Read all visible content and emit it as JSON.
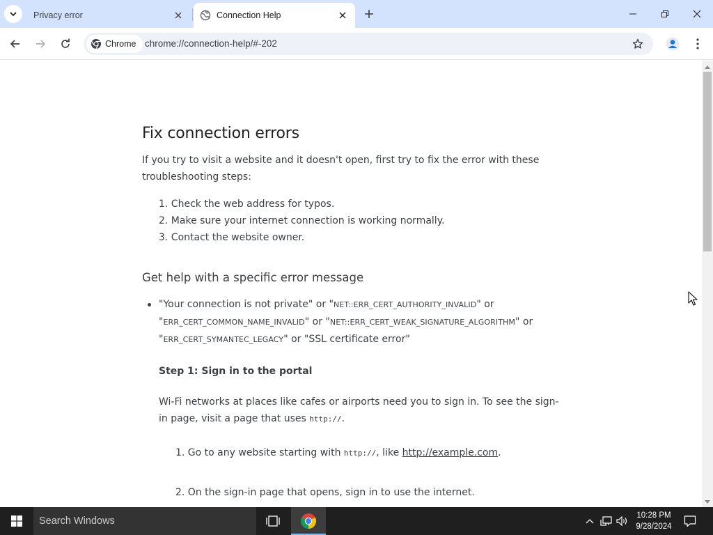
{
  "tabs": [
    {
      "title": "Privacy error",
      "active": false
    },
    {
      "title": "Connection Help",
      "active": true
    }
  ],
  "toolbar": {
    "site_chip": "Chrome",
    "url": "chrome://connection-help/#-202"
  },
  "page": {
    "title": "Fix connection errors",
    "intro": "If you try to visit a website and it doesn't open, first try to fix the error with these troubleshooting steps:",
    "steps": [
      "1. Check the web address for typos.",
      "2. Make sure your internet connection is working normally.",
      "3. Contact the website owner."
    ],
    "section_title": "Get help with a specific error message",
    "error_item": {
      "q1": "\"Your connection is not private\" or \"",
      "c1": "NET::ERR_CERT_AUTHORITY_INVALID",
      "q2": "\" or \"",
      "c2": "ERR_CERT_COMMON_NAME_INVALID",
      "q3": "\" or \"",
      "c3": "NET::ERR_CERT_WEAK_SIGNATURE_ALGORITHM",
      "q4": "\" or \"",
      "c4": "ERR_CERT_SYMANTEC_LEGACY",
      "q5": "\" or \"SSL certificate error\""
    },
    "step1_title": "Step 1: Sign in to the portal",
    "wifi_para_a": "Wi-Fi networks at places like cafes or airports need you to sign in. To see the sign-in page, visit a page that uses ",
    "wifi_code": "http://",
    "wifi_para_b": ".",
    "substep1_a": "1. Go to any website starting with ",
    "substep1_code": "http://",
    "substep1_b": ", like ",
    "substep1_link": "http://example.com",
    "substep1_c": ".",
    "substep2": "2. On the sign-in page that opens, sign in to use the internet."
  },
  "taskbar": {
    "search_placeholder": "Search Windows",
    "time": "10:28 PM",
    "date": "9/28/2024"
  },
  "colors": {
    "tabstrip": "#d3e3fd",
    "omnibox": "#eef1f8",
    "taskbar": "#1f1f1f"
  }
}
